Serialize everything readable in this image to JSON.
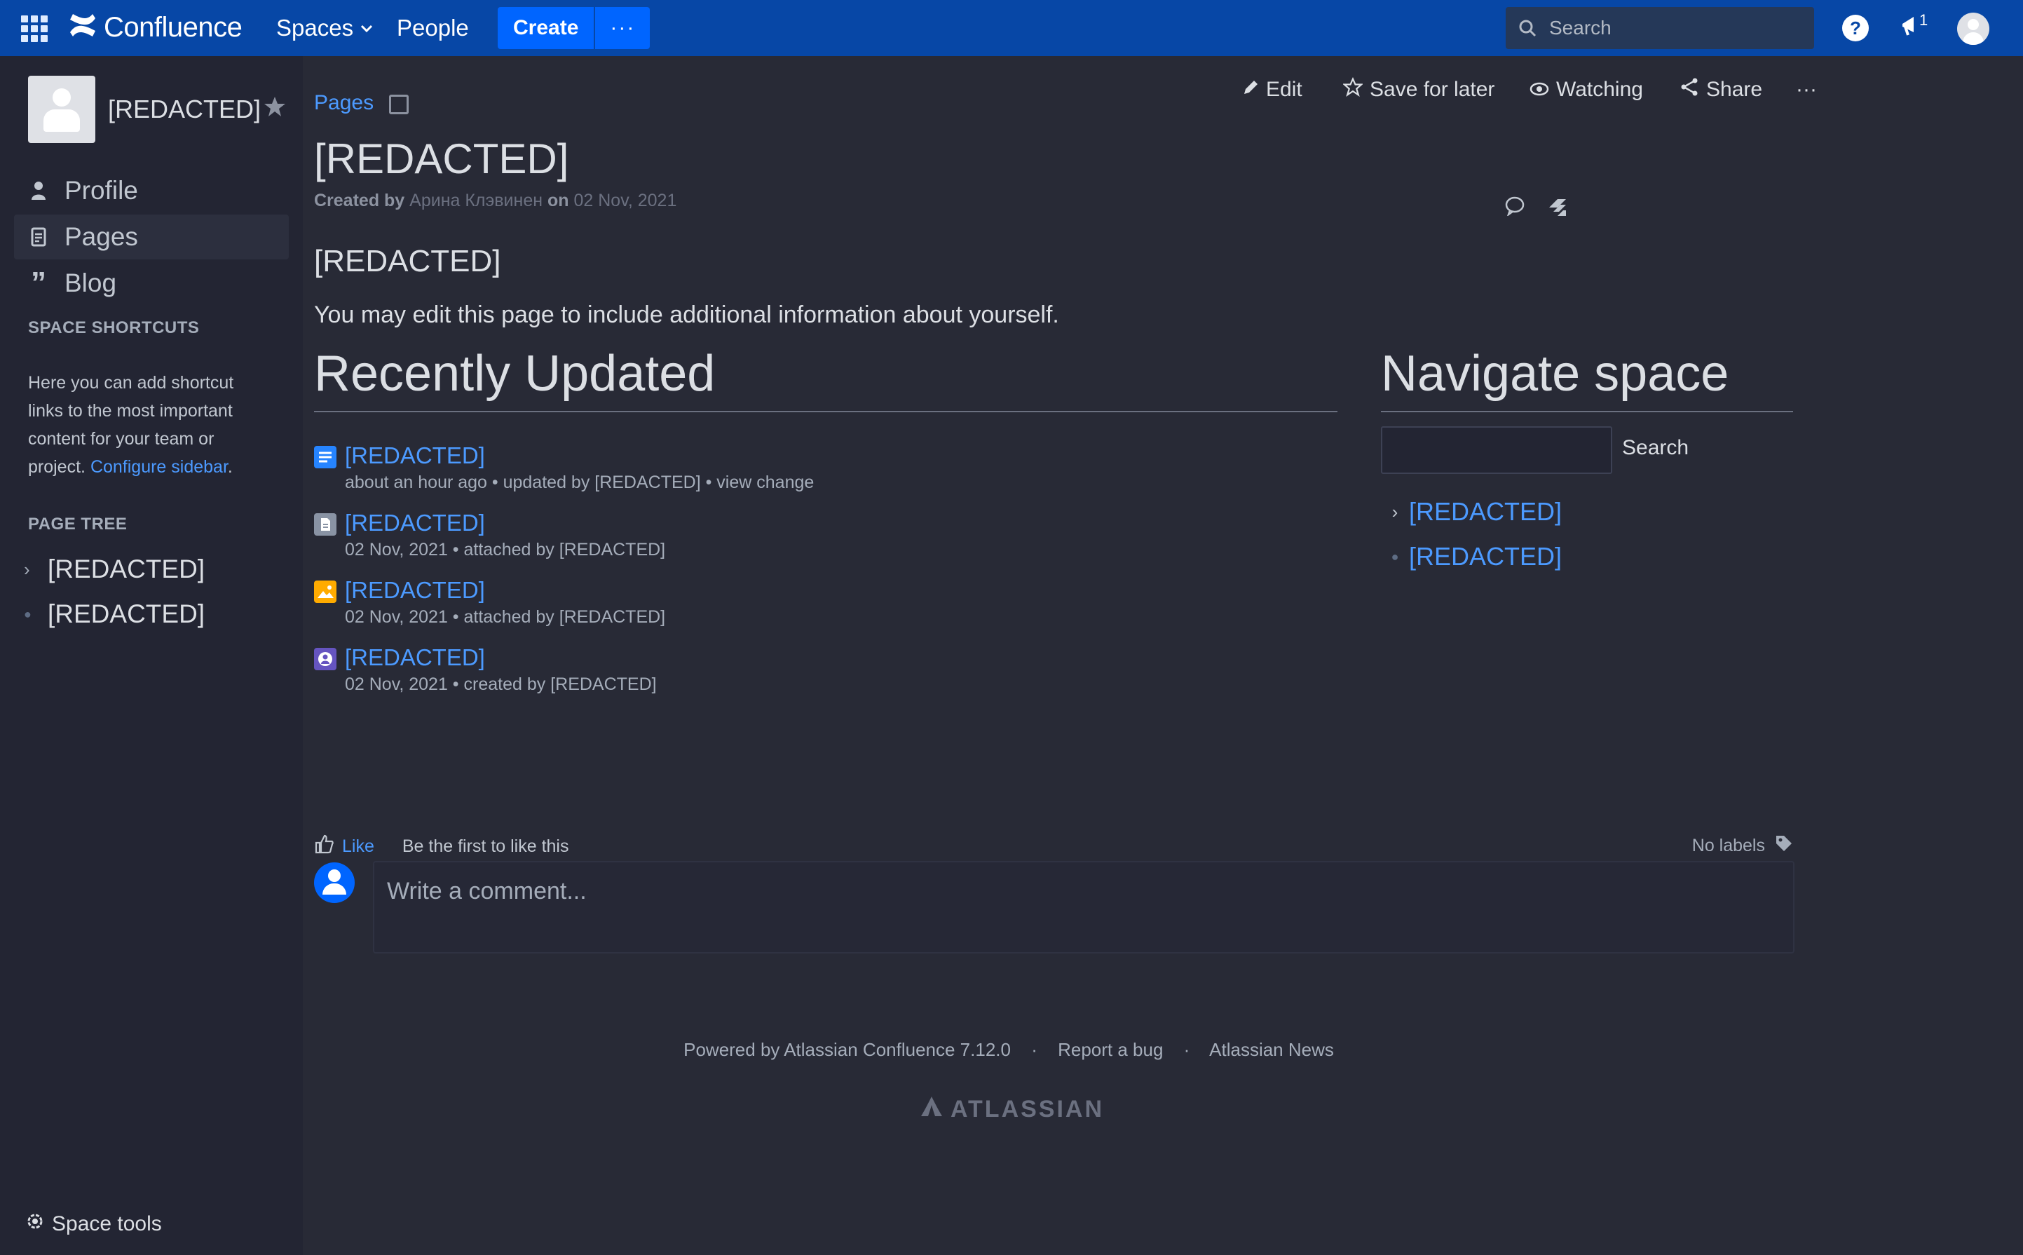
{
  "topbar": {
    "logo_text": "Confluence",
    "spaces": "Spaces",
    "people": "People",
    "create": "Create",
    "more": "···",
    "search_placeholder": "Search",
    "notif_count": "1"
  },
  "sidebar": {
    "space_name": "[REDACTED]",
    "nav": [
      {
        "label": "Profile",
        "icon": "person-icon"
      },
      {
        "label": "Pages",
        "icon": "pages-icon"
      },
      {
        "label": "Blog",
        "icon": "quote-icon"
      }
    ],
    "shortcuts_title": "SPACE SHORTCUTS",
    "shortcuts_text": "Here you can add shortcut links to the most important content for your team or project.",
    "configure_link": "Configure sidebar",
    "page_tree_title": "PAGE TREE",
    "tree": [
      "[REDACTED]",
      "[REDACTED]"
    ],
    "space_tools": "Space tools"
  },
  "page": {
    "breadcrumb": "Pages",
    "actions": {
      "edit": "Edit",
      "save": "Save for later",
      "watching": "Watching",
      "share": "Share",
      "more": "···"
    },
    "title": "[REDACTED]",
    "byline": {
      "created_by": "Created by",
      "author": "Арина Клэвинен",
      "on": "on",
      "date": "02 Nov, 2021"
    },
    "section_heading": "[REDACTED]",
    "intro": "You may edit this page to include additional information about yourself.",
    "recent_title": "Recently Updated",
    "recent": [
      {
        "title": "[REDACTED]",
        "meta": "about an hour ago • updated by [REDACTED] • view change",
        "icon": "page-icon",
        "color": "#2684ff"
      },
      {
        "title": "[REDACTED]",
        "meta": "02 Nov, 2021 • attached by [REDACTED]",
        "icon": "file-icon",
        "color": "#8993a4"
      },
      {
        "title": "[REDACTED]",
        "meta": "02 Nov, 2021 • attached by [REDACTED]",
        "icon": "image-icon",
        "color": "#ffab00"
      },
      {
        "title": "[REDACTED]",
        "meta": "02 Nov, 2021 • created by [REDACTED]",
        "icon": "profile-icon",
        "color": "#6554c0"
      }
    ],
    "navigate_title": "Navigate space",
    "navigate_search_button": "Search",
    "navigate_tree": [
      "[REDACTED]",
      "[REDACTED]"
    ],
    "like": "Like",
    "like_text": "Be the first to like this",
    "no_labels": "No labels",
    "comment_placeholder": "Write a comment..."
  },
  "footer": {
    "powered": "Powered by Atlassian Confluence 7.12.0",
    "report": "Report a bug",
    "news": "Atlassian News",
    "brand": "ATLASSIAN"
  }
}
